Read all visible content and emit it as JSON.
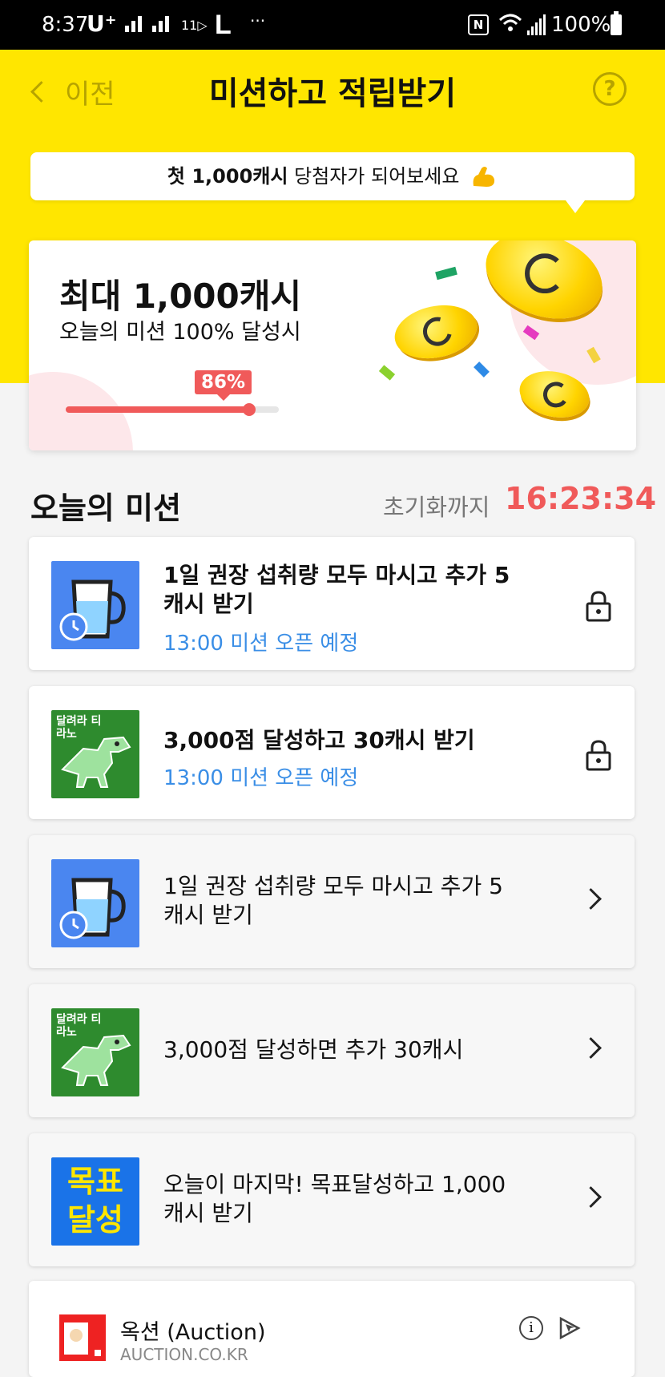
{
  "status": {
    "time": "8:37",
    "carrier": "U⁺",
    "network": "11▷",
    "carrier2": "L",
    "more": "···",
    "nfc": "N",
    "battery": "100%"
  },
  "header": {
    "back_label": "이전",
    "title": "미션하고 적립받기",
    "help_icon": "?"
  },
  "promo": {
    "bold": "첫 1,000캐시",
    "rest": " 당첨자가 되어보세요"
  },
  "hero": {
    "max_label": "최대 1,000캐시",
    "condition": "오늘의 미션 100% 달성시",
    "progress_label": "86%",
    "progress_value": 0.86
  },
  "missions_section": {
    "title": "오늘의 미션",
    "reset_label": "초기화까지",
    "reset_time": "16:23:34"
  },
  "missions": [
    {
      "title": "1일 권장 섭취량 모두 마시고 추가 5캐시 받기",
      "status": "13:00 미션 오픈 예정",
      "icon": "water-cup-alarm-icon",
      "locked": true
    },
    {
      "title": "3,000점 달성하고 30캐시 받기",
      "status": "13:00 미션 오픈 예정",
      "icon": "dino-game-icon",
      "locked": true,
      "thumb_text": "달려라 티라노"
    },
    {
      "title": "1일 권장 섭취량 모두 마시고 추가 5캐시 받기",
      "icon": "water-cup-alarm-icon",
      "locked": false
    },
    {
      "title": "3,000점 달성하면 추가 30캐시",
      "icon": "dino-game-icon",
      "locked": false,
      "thumb_text": "달려라 티라노"
    },
    {
      "title": "오늘이 마지막! 목표달성하고 1,000캐시 받기",
      "icon": "goal-achieve-icon",
      "locked": false,
      "thumb_text": "목표 달성"
    }
  ],
  "ad": {
    "name": "옥션 (Auction)",
    "url": "AUCTION.CO.KR"
  },
  "colors": {
    "yellow": "#ffe600",
    "accent_red": "#f05a5a",
    "link_blue": "#3a8ee6"
  }
}
